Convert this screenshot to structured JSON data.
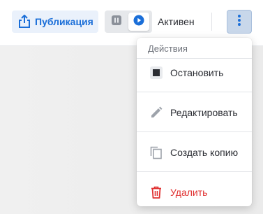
{
  "toolbar": {
    "publish_label": "Публикация",
    "status_label": "Активен",
    "publish_icon": "share-upload-icon",
    "pause_icon": "pause-icon",
    "play_icon": "play-icon",
    "more_icon": "vertical-dots-icon"
  },
  "menu": {
    "header": "Действия",
    "items": [
      {
        "label": "Остановить",
        "icon": "stop-icon"
      },
      {
        "label": "Редактировать",
        "icon": "pencil-icon"
      },
      {
        "label": "Создать копию",
        "icon": "copy-icon"
      },
      {
        "label": "Удалить",
        "icon": "trash-icon",
        "danger": true
      }
    ]
  },
  "colors": {
    "accent": "#1a6ed8",
    "danger": "#e03131",
    "more_button_bg": "#c8d7ea"
  }
}
